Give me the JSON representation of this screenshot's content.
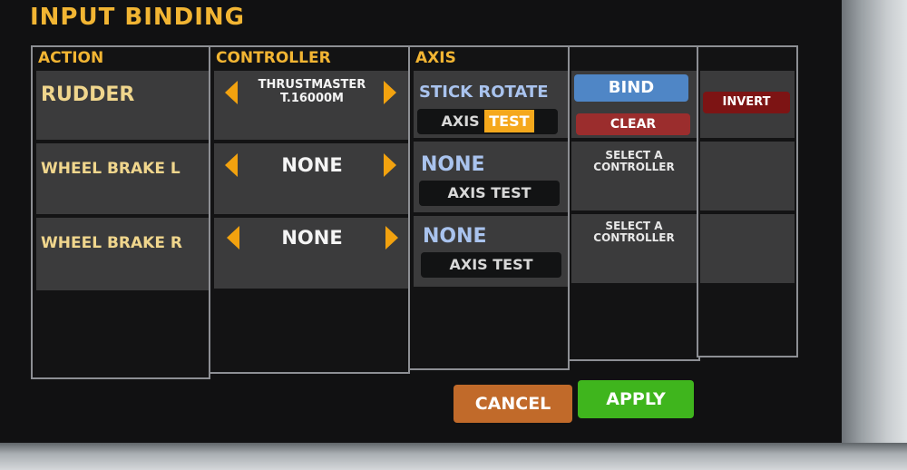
{
  "title": "INPUT BINDING",
  "columns": {
    "action": "ACTION",
    "controller": "CONTROLLER",
    "axis": "AXIS"
  },
  "rows": [
    {
      "action": "RUDDER",
      "controller": "THRUSTMASTER T.16000M",
      "axis": "STICK ROTATE",
      "axis_test": "AXIS ",
      "axis_test_highlight": "TEST",
      "bind": "BIND",
      "clear": "CLEAR",
      "invert": "INVERT"
    },
    {
      "action": "WHEEL BRAKE L",
      "controller": "NONE",
      "axis": "NONE",
      "axis_test": "AXIS TEST",
      "select_controller": "SELECT A CONTROLLER"
    },
    {
      "action": "WHEEL BRAKE R",
      "controller": "NONE",
      "axis": "NONE",
      "axis_test": "AXIS TEST",
      "select_controller": "SELECT A CONTROLLER"
    }
  ],
  "footer": {
    "cancel": "CANCEL",
    "apply": "APPLY"
  },
  "colors": {
    "accent": "#f2b533",
    "bind": "#4f86c6",
    "clear": "#9b2d2d",
    "invert": "#7d1414",
    "cancel": "#c16a2a",
    "apply": "#3fb51d"
  },
  "icons": [
    "chevron-left-icon",
    "chevron-right-icon"
  ]
}
